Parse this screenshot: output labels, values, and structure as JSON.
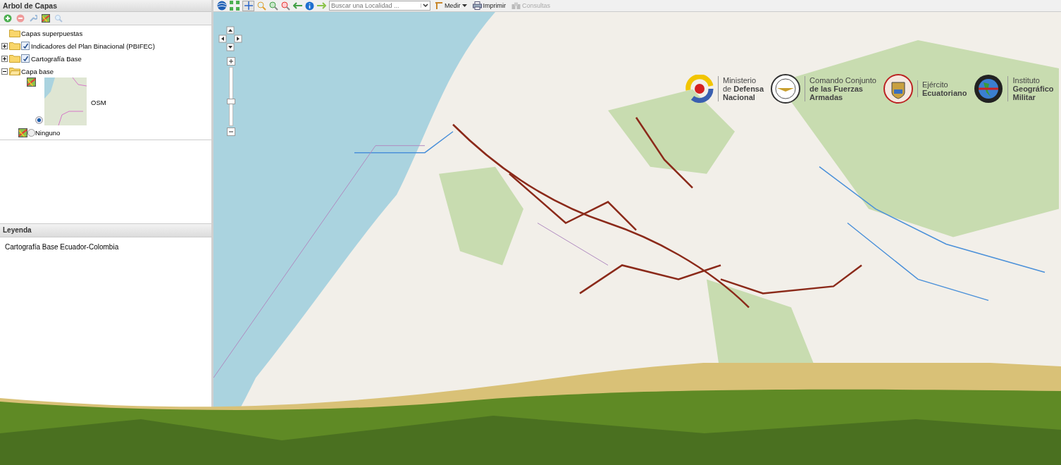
{
  "layers_panel": {
    "title": "Arbol de Capas"
  },
  "tree": [
    {
      "label": "Capas superpuestas",
      "kind": "folder"
    },
    {
      "label": "Indicadores del Plan Binacional (PBIFEC)",
      "kind": "check-folder",
      "expanded": false,
      "checked": true
    },
    {
      "label": "Cartografía Base",
      "kind": "check-folder",
      "expanded": false,
      "checked": true
    },
    {
      "label": "Capa base",
      "kind": "radio-folder",
      "expanded": true,
      "children": [
        {
          "label": "OSM",
          "kind": "thumb",
          "selected": true
        },
        {
          "label": "Ninguno",
          "kind": "plain",
          "selected": false
        }
      ]
    }
  ],
  "legend": {
    "title": "Leyenda",
    "text": "Cartografía Base Ecuador-Colombia"
  },
  "zoom_slider": {
    "level": 0.4
  },
  "map_toolbar": {
    "search": {
      "placeholder": "Buscar una Localidad ..."
    },
    "buttons": [
      {
        "label": "Medir",
        "kind": "measure",
        "disabled": false
      },
      {
        "label": "Imprimir",
        "kind": "print",
        "disabled": false
      },
      {
        "label": "Consultas",
        "kind": "query",
        "disabled": true
      }
    ]
  },
  "logos": [
    {
      "kind": "ring",
      "lines": [
        "Ministerio",
        "de **Defensa**",
        "**Nacional**"
      ]
    },
    {
      "kind": "seal",
      "lines": [
        "Comando Conjunto",
        "**de las Fuerzas**",
        "**Armadas**"
      ]
    },
    {
      "kind": "shield",
      "lines": [
        "Ejército",
        "**Ecuatoriano**"
      ]
    },
    {
      "kind": "globe",
      "lines": [
        "Instituto",
        "**Geográfico**",
        "**Militar**"
      ]
    }
  ]
}
